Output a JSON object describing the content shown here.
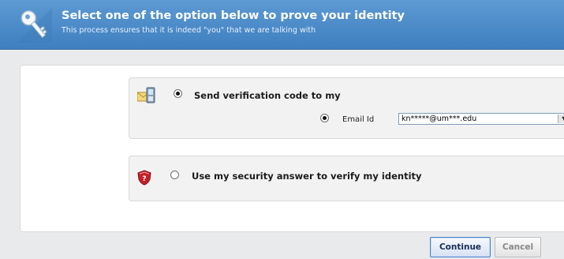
{
  "header": {
    "title": "Select one of the option below to prove your identity",
    "subtitle": "This process ensures that it is indeed \"you\" that we are talking with",
    "icon": "key-icon"
  },
  "options": {
    "send_code": {
      "label": "Send verification code to my",
      "icon": "email-phone-icon",
      "selected": true,
      "channel": {
        "label": "Email Id",
        "selected": true,
        "value": "kn*****@um***.edu"
      }
    },
    "security_answer": {
      "label": "Use my security answer to verify my identity",
      "icon": "security-shield-icon",
      "selected": false
    }
  },
  "buttons": {
    "continue": "Continue",
    "cancel": "Cancel"
  },
  "colors": {
    "header": "#4a89c8",
    "primary_border": "#4d82c7"
  }
}
